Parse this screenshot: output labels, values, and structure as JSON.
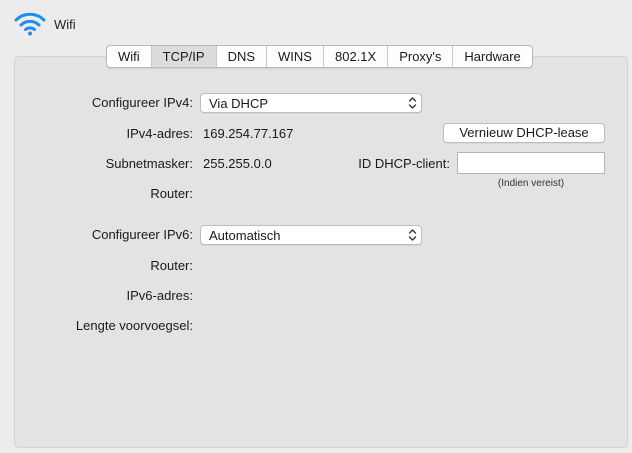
{
  "header": {
    "title": "Wifi",
    "icon": "wifi-icon"
  },
  "tabs": [
    {
      "label": "Wifi"
    },
    {
      "label": "TCP/IP",
      "active": true
    },
    {
      "label": "DNS"
    },
    {
      "label": "WINS"
    },
    {
      "label": "802.1X"
    },
    {
      "label": "Proxy's"
    },
    {
      "label": "Hardware"
    }
  ],
  "ipv4": {
    "configure_label": "Configureer IPv4:",
    "configure_value": "Via DHCP",
    "address_label": "IPv4-adres:",
    "address_value": "169.254.77.167",
    "subnet_label": "Subnetmasker:",
    "subnet_value": "255.255.0.0",
    "router_label": "Router:",
    "router_value": ""
  },
  "dhcp": {
    "renew_button": "Vernieuw DHCP-lease",
    "client_id_label": "ID DHCP-client:",
    "client_id_value": "",
    "client_id_hint": "(Indien vereist)"
  },
  "ipv6": {
    "configure_label": "Configureer IPv6:",
    "configure_value": "Automatisch",
    "router_label": "Router:",
    "router_value": "",
    "address_label": "IPv6-adres:",
    "address_value": "",
    "prefix_label": "Lengte voorvoegsel:",
    "prefix_value": ""
  },
  "colors": {
    "wifi_icon": "#1d8df0",
    "panel_bg": "#e3e3e3",
    "window_bg": "#ececec"
  }
}
